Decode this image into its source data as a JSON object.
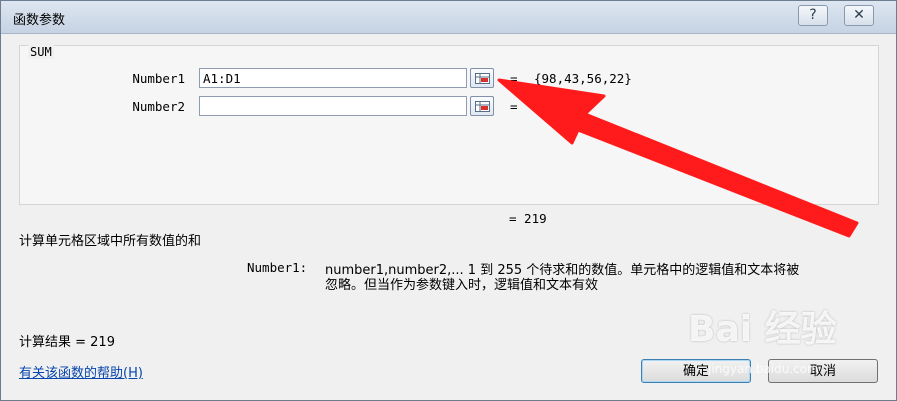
{
  "window": {
    "title": "函数参数",
    "help_glyph": "?",
    "close_glyph": "✕"
  },
  "function": {
    "name": "SUM"
  },
  "args": [
    {
      "label": "Number1",
      "value": "A1:D1",
      "eq": "=",
      "result": "{98,43,56,22}"
    },
    {
      "label": "Number2",
      "value": "",
      "eq": "=",
      "result": ""
    }
  ],
  "formula_result_eq": "= 219",
  "description": "计算单元格区域中所有数值的和",
  "arg_help": {
    "label": "Number1:",
    "line1": "number1,number2,...  1 到 255 个待求和的数值。单元格中的逻辑值和文本将被",
    "line2": "忽略。但当作为参数键入时，逻辑值和文本有效"
  },
  "calc_result": "计算结果 =  219",
  "help_link": "有关该函数的帮助(H)",
  "buttons": {
    "ok": "确定",
    "cancel": "取消"
  },
  "watermark": {
    "text": "Bai 经验",
    "sub": "jingyan.baidu.com"
  },
  "colors": {
    "arrow": "#ff1b1b",
    "link": "#0645ad"
  }
}
